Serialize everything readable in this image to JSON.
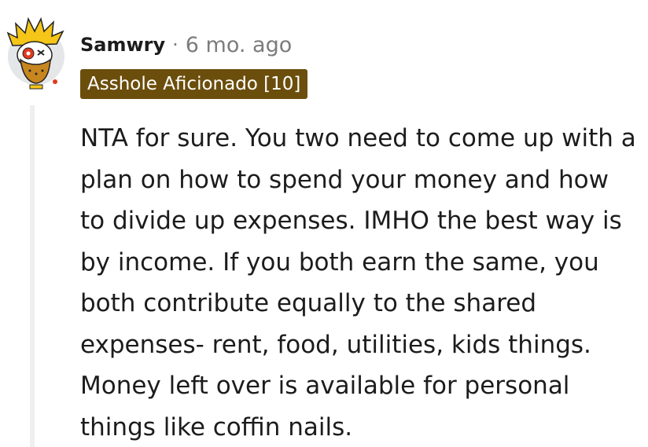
{
  "comment": {
    "author": "Samwry",
    "separator": "·",
    "timestamp": "6 mo. ago",
    "flair": "Asshole Aficionado [10]",
    "body": "NTA for sure. You two need to come up with a plan on how to spend your money and how to divide up expenses. IMHO the best way is by income. If you both earn the same, you both contribute equally to the shared expenses- rent, food, utilities, kids things. Money left over is available for personal things like coffin nails."
  },
  "icons": {
    "avatar": "snoo-avatar-icon"
  },
  "colors": {
    "flair_background": "#6b4e0c",
    "flair_text": "#ffffff",
    "muted_text": "#7c7c7c",
    "body_text": "#1c1c1c",
    "thread_line": "#edeff1"
  }
}
